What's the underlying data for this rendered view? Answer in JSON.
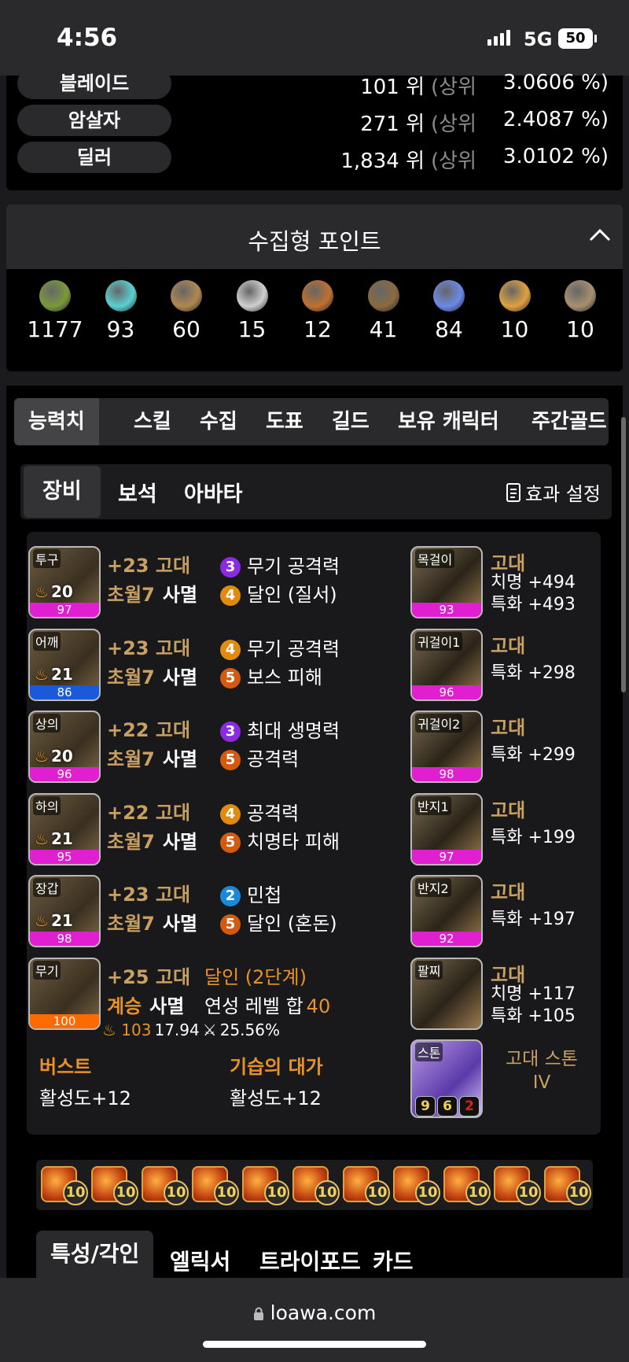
{
  "status": {
    "time": "4:56",
    "network": "5G",
    "battery": "50"
  },
  "ranks": [
    {
      "class": "블레이드",
      "rank": "101 위",
      "pre": "(상위",
      "pct": "3.0606 %)"
    },
    {
      "class": "암살자",
      "rank": "271 위",
      "pre": "(상위",
      "pct": "2.4087 %)"
    },
    {
      "class": "딜러",
      "rank": "1,834 위",
      "pre": "(상위",
      "pct": "3.0102 %)"
    }
  ],
  "collect": {
    "title": "수집형 포인트",
    "items": [
      {
        "icon": "mokoko-seed-icon",
        "value": "1177",
        "color": "#7a9a3a"
      },
      {
        "icon": "island-heart-icon",
        "value": "93",
        "color": "#5ad0d0"
      },
      {
        "icon": "adventure-map-icon",
        "value": "60",
        "color": "#b08850"
      },
      {
        "icon": "giant-heart-icon",
        "value": "15",
        "color": "#cfcfcf"
      },
      {
        "icon": "ignea-token-icon",
        "value": "12",
        "color": "#c07030"
      },
      {
        "icon": "sea-bounty-icon",
        "value": "41",
        "color": "#8a6a40"
      },
      {
        "icon": "world-tree-leaf-icon",
        "value": "84",
        "color": "#6a8ae8"
      },
      {
        "icon": "orpheus-star-icon",
        "value": "10",
        "color": "#e0a040"
      },
      {
        "icon": "masterpiece-icon",
        "value": "10",
        "color": "#a89070"
      }
    ]
  },
  "tabs": [
    "능력치",
    "스킬",
    "수집",
    "도표",
    "길드",
    "보유 캐릭터",
    "주간골드획"
  ],
  "subtabs": [
    "장비",
    "보석",
    "아바타"
  ],
  "effect_label": "효과 설정",
  "equipment": [
    {
      "slot": "투구",
      "level": "20",
      "quality": "97",
      "qcolor": "#e020d0",
      "upgrade": "+23 고대",
      "set": "초월7",
      "set_name": "사멸",
      "opts": [
        {
          "n": "3",
          "c": "#8a2be2",
          "t": "무기 공격력"
        },
        {
          "n": "4",
          "c": "#e08a10",
          "t": "달인 (질서)"
        }
      ]
    },
    {
      "slot": "어깨",
      "level": "21",
      "quality": "86",
      "qcolor": "#1a5ad8",
      "upgrade": "+23 고대",
      "set": "초월7",
      "set_name": "사멸",
      "opts": [
        {
          "n": "4",
          "c": "#e08a10",
          "t": "무기 공격력"
        },
        {
          "n": "5",
          "c": "#d45a10",
          "t": "보스 피해"
        }
      ]
    },
    {
      "slot": "상의",
      "level": "20",
      "quality": "96",
      "qcolor": "#e020d0",
      "upgrade": "+22 고대",
      "set": "초월7",
      "set_name": "사멸",
      "opts": [
        {
          "n": "3",
          "c": "#8a2be2",
          "t": "최대 생명력"
        },
        {
          "n": "5",
          "c": "#d45a10",
          "t": "공격력"
        }
      ]
    },
    {
      "slot": "하의",
      "level": "21",
      "quality": "95",
      "qcolor": "#e020d0",
      "upgrade": "+22 고대",
      "set": "초월7",
      "set_name": "사멸",
      "opts": [
        {
          "n": "4",
          "c": "#e08a10",
          "t": "공격력"
        },
        {
          "n": "5",
          "c": "#d45a10",
          "t": "치명타 피해"
        }
      ]
    },
    {
      "slot": "장갑",
      "level": "21",
      "quality": "98",
      "qcolor": "#e020d0",
      "upgrade": "+23 고대",
      "set": "초월7",
      "set_name": "사멸",
      "opts": [
        {
          "n": "2",
          "c": "#1a8ad8",
          "t": "민첩"
        },
        {
          "n": "5",
          "c": "#d45a10",
          "t": "달인 (혼돈)"
        }
      ]
    }
  ],
  "weapon": {
    "slot": "무기",
    "quality": "100",
    "upgrade": "+25 고대",
    "elixir": "달인 (2단계)",
    "set": "계승",
    "set_name": "사멸",
    "elixir_sum_label": "연성 레벨 합",
    "elixir_sum": "40",
    "trans_level": "103",
    "trans_pct": "17.94",
    "sharpen_pct": "25.56%"
  },
  "engrave_effects": [
    {
      "name": "버스트",
      "value": "활성도+12"
    },
    {
      "name": "기습의 대가",
      "value": "활성도+12"
    }
  ],
  "accessories": [
    {
      "slot": "목걸이",
      "quality": "93",
      "grade": "고대",
      "stats": [
        "치명 +494",
        "특화 +493"
      ]
    },
    {
      "slot": "귀걸이1",
      "quality": "96",
      "grade": "고대",
      "stats": [
        "특화 +298"
      ]
    },
    {
      "slot": "귀걸이2",
      "quality": "98",
      "grade": "고대",
      "stats": [
        "특화 +299"
      ]
    },
    {
      "slot": "반지1",
      "quality": "97",
      "grade": "고대",
      "stats": [
        "특화 +199"
      ]
    },
    {
      "slot": "반지2",
      "quality": "92",
      "grade": "고대",
      "stats": [
        "특화 +197"
      ]
    },
    {
      "slot": "팔찌",
      "quality": "",
      "grade": "고대",
      "stats": [
        "치명 +117",
        "특화 +105"
      ]
    }
  ],
  "stone": {
    "slot": "스톤",
    "name": "고대 스톤",
    "tier": "IV",
    "n1": "9",
    "n2": "6",
    "n3": "2"
  },
  "gems": [
    "10",
    "10",
    "10",
    "10",
    "10",
    "10",
    "10",
    "10",
    "10",
    "10",
    "10"
  ],
  "bottom_tabs": [
    "특성/각인",
    "엘릭서",
    "트라이포드",
    "카드"
  ],
  "url": "loawa.com"
}
